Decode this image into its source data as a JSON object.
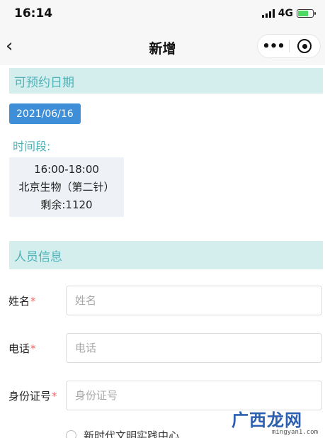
{
  "status_bar": {
    "time": "16:14",
    "network": "4G"
  },
  "nav": {
    "back_icon": "‹",
    "title": "新增",
    "more_icon": "•••"
  },
  "appointment": {
    "section_title": "可预约日期",
    "date": "2021/06/16",
    "slot_label": "时间段:",
    "slot": {
      "time": "16:00-18:00",
      "vaccine": "北京生物（第二针）",
      "remaining": "剩余:1120"
    }
  },
  "person": {
    "section_title": "人员信息",
    "name": {
      "label": "姓名",
      "required_mark": "*",
      "placeholder": "姓名"
    },
    "phone": {
      "label": "电话",
      "required_mark": "*",
      "placeholder": "电话"
    },
    "id_number": {
      "label": "身份证号",
      "required_mark": "*",
      "placeholder": "身份证号"
    }
  },
  "partial_option_label": "新时代文明实践中心",
  "watermark": {
    "text": "广西龙网",
    "sub": "mingyan1.com"
  },
  "colors": {
    "section_bg": "#d4eeee",
    "section_text": "#4fb3b8",
    "date_chip": "#3f8fd8",
    "required": "#e86a6a"
  }
}
